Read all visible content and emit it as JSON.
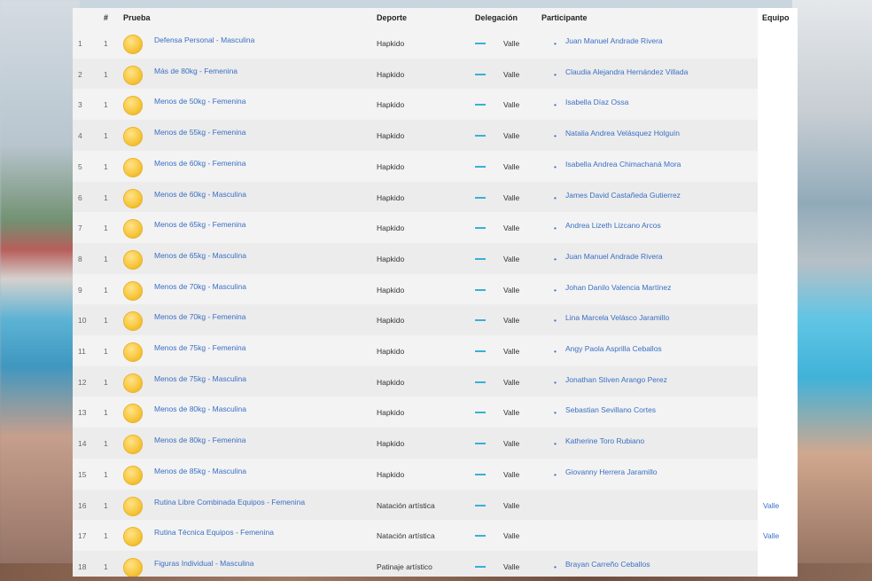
{
  "table": {
    "headers": {
      "num": "#",
      "prueba": "Prueba",
      "deporte": "Deporte",
      "delegacion": "Delegación",
      "participante": "Participante",
      "equipo": "Equipo"
    },
    "rows": [
      {
        "idx": "1",
        "num": "1",
        "prueba": "Defensa Personal - Masculina",
        "deporte": "Hapkido",
        "delegacion": "Valle",
        "participante": "Juan Manuel Andrade Rivera",
        "equipo": ""
      },
      {
        "idx": "2",
        "num": "1",
        "prueba": "Más de 80kg - Femenina",
        "deporte": "Hapkido",
        "delegacion": "Valle",
        "participante": "Claudia Alejandra Hernández Villada",
        "equipo": ""
      },
      {
        "idx": "3",
        "num": "1",
        "prueba": "Menos de 50kg - Femenina",
        "deporte": "Hapkido",
        "delegacion": "Valle",
        "participante": "Isabella Díaz Ossa",
        "equipo": ""
      },
      {
        "idx": "4",
        "num": "1",
        "prueba": "Menos de 55kg - Femenina",
        "deporte": "Hapkido",
        "delegacion": "Valle",
        "participante": "Natalia Andrea Velásquez Holguín",
        "equipo": ""
      },
      {
        "idx": "5",
        "num": "1",
        "prueba": "Menos de 60kg - Femenina",
        "deporte": "Hapkido",
        "delegacion": "Valle",
        "participante": "Isabella Andrea Chimachaná Mora",
        "equipo": ""
      },
      {
        "idx": "6",
        "num": "1",
        "prueba": "Menos de 60kg - Masculina",
        "deporte": "Hapkido",
        "delegacion": "Valle",
        "participante": "James David Castañeda Gutierrez",
        "equipo": ""
      },
      {
        "idx": "7",
        "num": "1",
        "prueba": "Menos de 65kg - Femenina",
        "deporte": "Hapkido",
        "delegacion": "Valle",
        "participante": "Andrea Lizeth Lizcano Arcos",
        "equipo": ""
      },
      {
        "idx": "8",
        "num": "1",
        "prueba": "Menos de 65kg - Masculina",
        "deporte": "Hapkido",
        "delegacion": "Valle",
        "participante": "Juan Manuel Andrade Rivera",
        "equipo": ""
      },
      {
        "idx": "9",
        "num": "1",
        "prueba": "Menos de 70kg - Masculina",
        "deporte": "Hapkido",
        "delegacion": "Valle",
        "participante": "Johan Danilo Valencia Martínez",
        "equipo": ""
      },
      {
        "idx": "10",
        "num": "1",
        "prueba": "Menos de 70kg - Femenina",
        "deporte": "Hapkido",
        "delegacion": "Valle",
        "participante": "Lina Marcela Velásco Jaramillo",
        "equipo": ""
      },
      {
        "idx": "11",
        "num": "1",
        "prueba": "Menos de 75kg - Femenina",
        "deporte": "Hapkido",
        "delegacion": "Valle",
        "participante": "Angy Paola Asprilla Ceballos",
        "equipo": ""
      },
      {
        "idx": "12",
        "num": "1",
        "prueba": "Menos de 75kg - Masculina",
        "deporte": "Hapkido",
        "delegacion": "Valle",
        "participante": "Jonathan Stiven Arango Perez",
        "equipo": ""
      },
      {
        "idx": "13",
        "num": "1",
        "prueba": "Menos de 80kg - Masculina",
        "deporte": "Hapkido",
        "delegacion": "Valle",
        "participante": "Sebastian Sevillano Cortes",
        "equipo": ""
      },
      {
        "idx": "14",
        "num": "1",
        "prueba": "Menos de 80kg - Femenina",
        "deporte": "Hapkido",
        "delegacion": "Valle",
        "participante": "Katherine Toro Rubiano",
        "equipo": ""
      },
      {
        "idx": "15",
        "num": "1",
        "prueba": "Menos de 85kg - Masculina",
        "deporte": "Hapkido",
        "delegacion": "Valle",
        "participante": "Giovanny Herrera Jaramillo",
        "equipo": ""
      },
      {
        "idx": "16",
        "num": "1",
        "prueba": "Rutina Libre Combinada Equipos - Femenina",
        "deporte": "Natación artística",
        "delegacion": "Valle",
        "participante": "",
        "equipo": "Valle"
      },
      {
        "idx": "17",
        "num": "1",
        "prueba": "Rutina Técnica Equipos - Femenina",
        "deporte": "Natación artística",
        "delegacion": "Valle",
        "participante": "",
        "equipo": "Valle"
      },
      {
        "idx": "18",
        "num": "1",
        "prueba": "Figuras Individual - Masculina",
        "deporte": "Patinaje artístico",
        "delegacion": "Valle",
        "participante": "Brayan Carreño Ceballos",
        "equipo": ""
      }
    ]
  },
  "colors": {
    "link": "#3a6fc4",
    "flag_accent": "#39b0d8",
    "medal_gold": "#f7c63b"
  }
}
